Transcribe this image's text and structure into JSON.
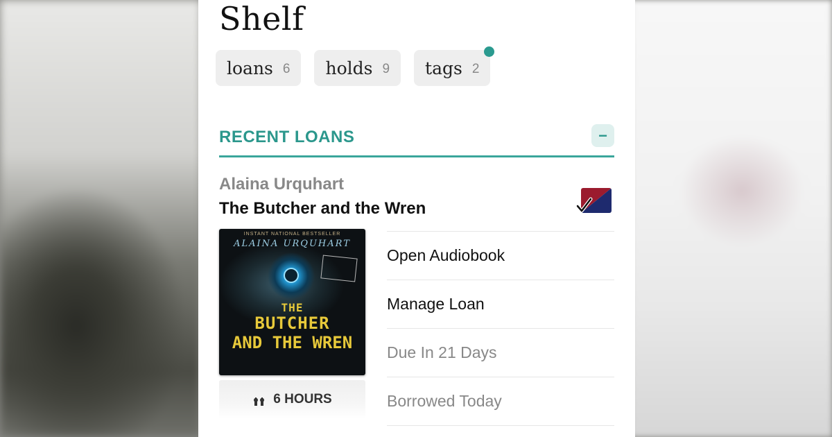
{
  "page": {
    "title": "Shelf"
  },
  "chips": [
    {
      "label": "loans",
      "count": "6"
    },
    {
      "label": "holds",
      "count": "9"
    },
    {
      "label": "tags",
      "count": "2"
    }
  ],
  "section": {
    "title": "RECENT LOANS",
    "collapse_label": "−"
  },
  "loan": {
    "author": "Alaina Urquhart",
    "title": "The Butcher and the Wren",
    "cover": {
      "tagline": "INSTANT NATIONAL BESTSELLER",
      "author": "ALAINA URQUHART",
      "line1": "THE",
      "line2": "BUTCHER",
      "line3": "AND THE WREN"
    },
    "duration": "6 HOURS",
    "actions": [
      {
        "label": "Open Audiobook"
      },
      {
        "label": "Manage Loan"
      },
      {
        "label": "Due In 21 Days"
      },
      {
        "label": "Borrowed Today"
      }
    ]
  },
  "colors": {
    "accent": "#2b978c",
    "badge_red": "#9b1b2e",
    "badge_blue": "#1e2a6e"
  }
}
